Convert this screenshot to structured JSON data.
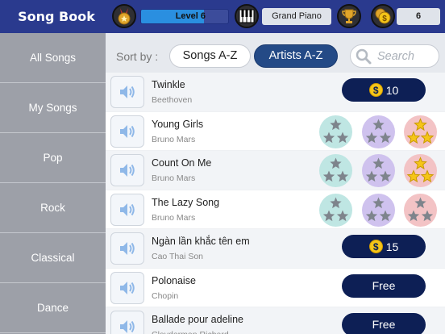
{
  "header": {
    "app_title": "Song Book",
    "level_label": "Level 6",
    "level_progress": 0.72,
    "instrument": "Grand Piano",
    "coins": "6",
    "icons": [
      "medal-icon",
      "piano-icon",
      "trophy-icon",
      "coins-icon"
    ]
  },
  "sidebar": {
    "items": [
      {
        "label": "All Songs"
      },
      {
        "label": "My Songs"
      },
      {
        "label": "Pop"
      },
      {
        "label": "Rock"
      },
      {
        "label": "Classical"
      },
      {
        "label": "Dance"
      }
    ]
  },
  "filter": {
    "sort_label": "Sort by :",
    "sort_options": [
      {
        "label": "Songs A-Z",
        "selected": false
      },
      {
        "label": "Artists A-Z",
        "selected": true
      }
    ],
    "search_placeholder": "Search"
  },
  "songs": [
    {
      "title": "Twinkle",
      "artist": "Beethoven",
      "action": "price",
      "price": "10"
    },
    {
      "title": "Young Girls",
      "artist": "Bruno Mars",
      "action": "badges",
      "badges": [
        2,
        3,
        3
      ]
    },
    {
      "title": "Count On Me",
      "artist": "Bruno Mars",
      "action": "badges",
      "badges": [
        2,
        3,
        3
      ]
    },
    {
      "title": "The Lazy Song",
      "artist": "Bruno Mars",
      "action": "badges",
      "badges": [
        2,
        3,
        0
      ]
    },
    {
      "title": "Ngàn lần khắc tên em",
      "artist": "Cao Thai Son",
      "action": "price",
      "price": "15"
    },
    {
      "title": "Polonaise",
      "artist": "Chopin",
      "action": "free",
      "free_label": "Free"
    },
    {
      "title": "Ballade pour adeline",
      "artist": "Clayderman Richard",
      "action": "free",
      "free_label": "Free"
    }
  ],
  "badge_earned": [
    [
      1,
      0,
      0
    ],
    [
      1,
      1,
      1
    ],
    [
      0,
      1,
      1
    ]
  ],
  "colors": {
    "header_bg": "#2a3a8e",
    "sidebar_bg": "#9da0a8",
    "button_dark": "#0d1f55",
    "star_gold": "#f5c518",
    "star_gray": "#7e848c"
  }
}
